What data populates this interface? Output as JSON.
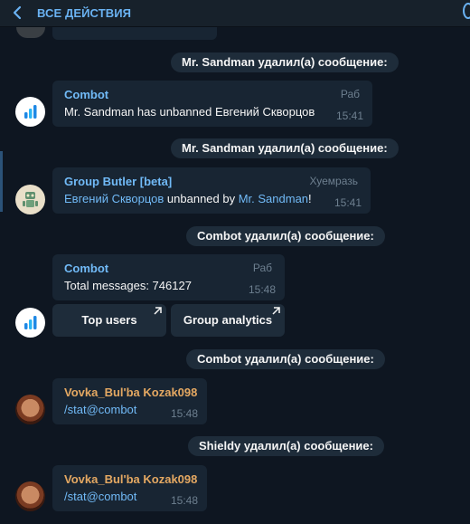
{
  "header": {
    "title": "ВСЕ ДЕЙСТВИЯ"
  },
  "events": {
    "deleted1": "Mr. Sandman удалил(а) сообщение:",
    "deleted2": "Mr. Sandman удалил(а) сообщение:",
    "deleted3": "Combot удалил(а) сообщение:",
    "deleted4": "Combot удалил(а) сообщение:",
    "deleted5": "Shieldy удалил(а) сообщение:"
  },
  "messages": {
    "m1": {
      "sender": "Combot",
      "badge": "Раб",
      "text": "Mr. Sandman has unbanned Евгений Скворцов",
      "time": "15:41"
    },
    "m2": {
      "sender": "Group Butler [beta]",
      "badge": "Хуемразь",
      "user_link": "Евгений Скворцов",
      "text_mid": " unbanned by ",
      "admin_link": "Mr. Sandman",
      "text_end": "!",
      "time": "15:41"
    },
    "m3": {
      "sender": "Combot",
      "badge": "Раб",
      "text": "Total messages: 746127",
      "time": "15:48",
      "buttons": {
        "top_users": "Top users",
        "group_analytics": "Group analytics"
      }
    },
    "m4": {
      "sender": "Vovka_Bul'ba Kozak098",
      "text": "/stat@combot",
      "time": "15:48"
    },
    "m5": {
      "sender": "Vovka_Bul'ba Kozak098",
      "text": "/stat@combot",
      "time": "15:48"
    }
  },
  "colors": {
    "background": "#0e1621",
    "bubble": "#182533",
    "accent": "#6ab2f2",
    "orange_name": "#e4a862"
  },
  "icons": [
    "back-arrow-icon",
    "combot-avatar-icon",
    "group-butler-robot-icon",
    "external-link-arrow-icon"
  ]
}
